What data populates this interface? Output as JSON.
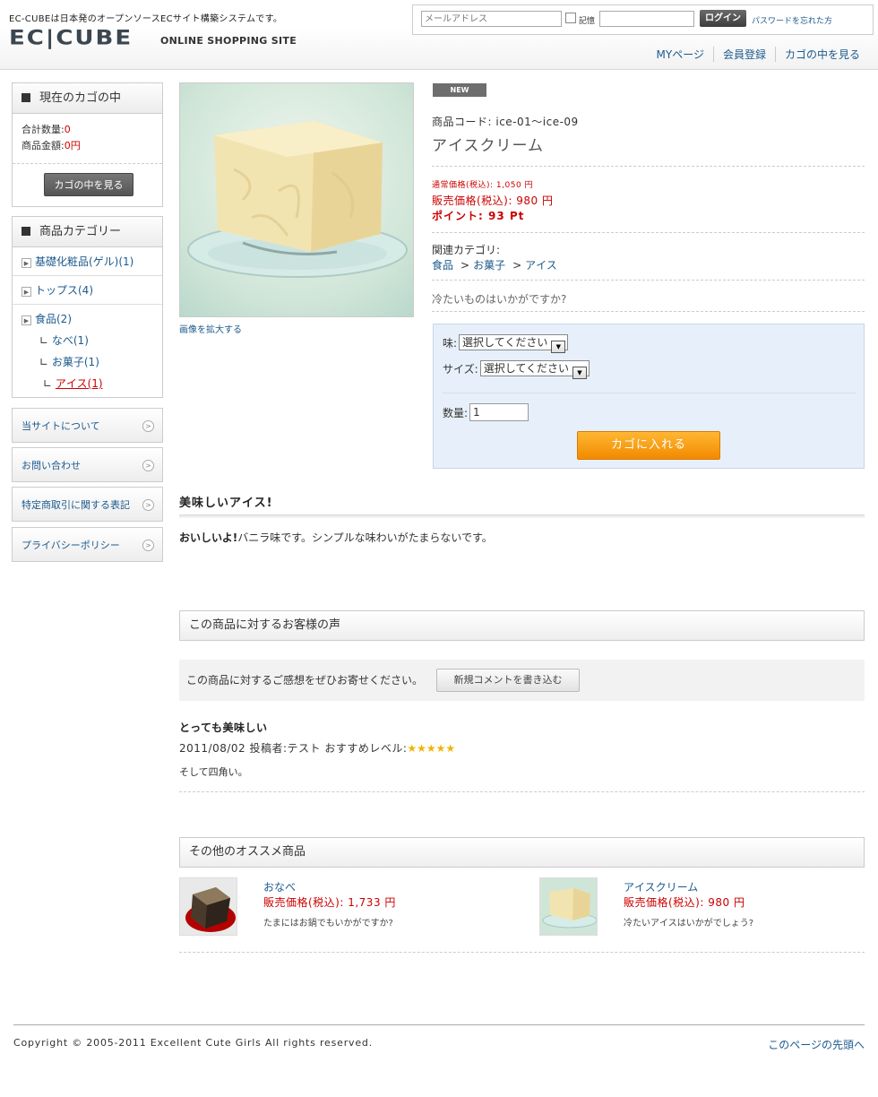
{
  "header": {
    "tagline": "EC-CUBEは日本発のオープンソースECサイト構築システムです。",
    "logo": "EC|CUBE",
    "logo_sub": "ONLINE SHOPPING SITE",
    "login": {
      "email_placeholder": "メールアドレス",
      "remember_label": "記憶",
      "login_button": "ログイン",
      "forgot_link": "パスワードを忘れた方"
    },
    "nav": [
      "MYページ",
      "会員登録",
      "カゴの中を見る"
    ]
  },
  "sidebar": {
    "cart": {
      "title": "現在のカゴの中",
      "total_qty_label": "合計数量:",
      "total_qty": "0",
      "total_price_label": "商品金額:",
      "total_price": "0円",
      "view_button": "カゴの中を見る"
    },
    "category": {
      "title": "商品カテゴリー",
      "items": [
        {
          "label": "基礎化粧品(ゲル)(1)"
        },
        {
          "label": "トップス(4)"
        },
        {
          "label": "食品(2)",
          "children": [
            "なべ(1)",
            "お菓子(1)",
            "アイス(1)"
          ]
        }
      ]
    },
    "links": [
      "当サイトについて",
      "お問い合わせ",
      "特定商取引に関する表記",
      "プライバシーポリシー"
    ]
  },
  "product": {
    "badge": "NEW",
    "zoom_link": "画像を拡大する",
    "code": "商品コード: ice-01～ice-09",
    "name": "アイスクリーム",
    "normal_price": "通常価格(税込): 1,050 円",
    "sale_price": "販売価格(税込): 980 円",
    "points": "ポイント: 93 Pt",
    "related_label": "関連カテゴリ:",
    "related": [
      "食品",
      "お菓子",
      "アイス"
    ],
    "description": "冷たいものはいかがですか?",
    "form": {
      "flavor_label": "味:",
      "flavor_value": "選択してください",
      "size_label": "サイズ:",
      "size_value": "選択してください",
      "qty_label": "数量:",
      "qty_value": "1",
      "add_button": "カゴに入れる"
    }
  },
  "sub": {
    "title": "美味しいアイス!",
    "text_bold": "おいしいよ!",
    "text": "バニラ味です。シンプルな味わいがたまらないです。"
  },
  "reviews": {
    "title": "この商品に対するお客様の声",
    "prompt": "この商品に対するご感想をぜひお寄せください。",
    "new_button": "新規コメントを書き込む",
    "items": [
      {
        "title": "とっても美味しい",
        "meta": "2011/08/02 投稿者:テスト おすすめレベル:",
        "stars": "★★★★★",
        "body": "そして四角い。"
      }
    ]
  },
  "recommend": {
    "title": "その他のオススメ商品",
    "items": [
      {
        "name": "おなべ",
        "price": "販売価格(税込): 1,733 円",
        "comment": "たまにはお鍋でもいかがですか?"
      },
      {
        "name": "アイスクリーム",
        "price": "販売価格(税込): 980 円",
        "comment": "冷たいアイスはいかがでしょう?"
      }
    ]
  },
  "footer": {
    "copyright": "Copyright © 2005-2011 Excellent Cute Girls All rights reserved.",
    "page_top": "このページの先頭へ"
  }
}
